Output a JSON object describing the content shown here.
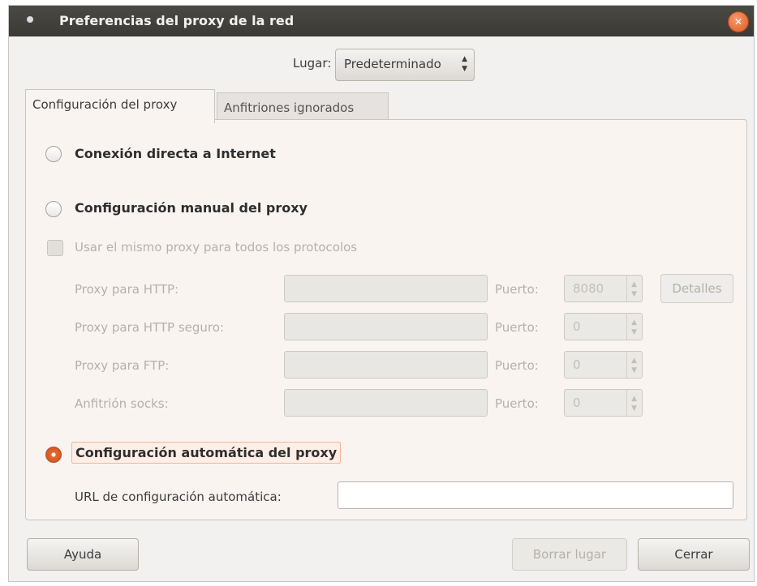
{
  "window": {
    "title": "Preferencias del proxy de la red",
    "close_icon": "close-icon"
  },
  "location": {
    "label": "Lugar:",
    "selected": "Predeterminado"
  },
  "tabs": [
    {
      "label": "Configuración del proxy",
      "active": true
    },
    {
      "label": "Anfitriones ignorados",
      "active": false
    }
  ],
  "proxy": {
    "direct": {
      "label": "Conexión directa a Internet",
      "selected": false
    },
    "manual": {
      "label": "Configuración manual del proxy",
      "selected": false
    },
    "same_proxy": {
      "label": "Usar el mismo proxy para todos los protocolos",
      "checked": false,
      "enabled": false
    },
    "rows": [
      {
        "label": "Proxy para HTTP:",
        "host": "",
        "port_label": "Puerto:",
        "port": "8080"
      },
      {
        "label": "Proxy para HTTP seguro:",
        "host": "",
        "port_label": "Puerto:",
        "port": "0"
      },
      {
        "label": "Proxy para FTP:",
        "host": "",
        "port_label": "Puerto:",
        "port": "0"
      },
      {
        "label": "Anfitrión socks:",
        "host": "",
        "port_label": "Puerto:",
        "port": "0"
      }
    ],
    "details_label": "Detalles",
    "auto": {
      "label": "Configuración automática del proxy",
      "selected": true
    },
    "auto_url": {
      "label": "URL de configuración automática:",
      "value": ""
    }
  },
  "buttons": {
    "help": "Ayuda",
    "delete_location": "Borrar lugar",
    "close": "Cerrar"
  },
  "colors": {
    "accent": "#e05a22",
    "titlebar": "#3f3e3a"
  }
}
